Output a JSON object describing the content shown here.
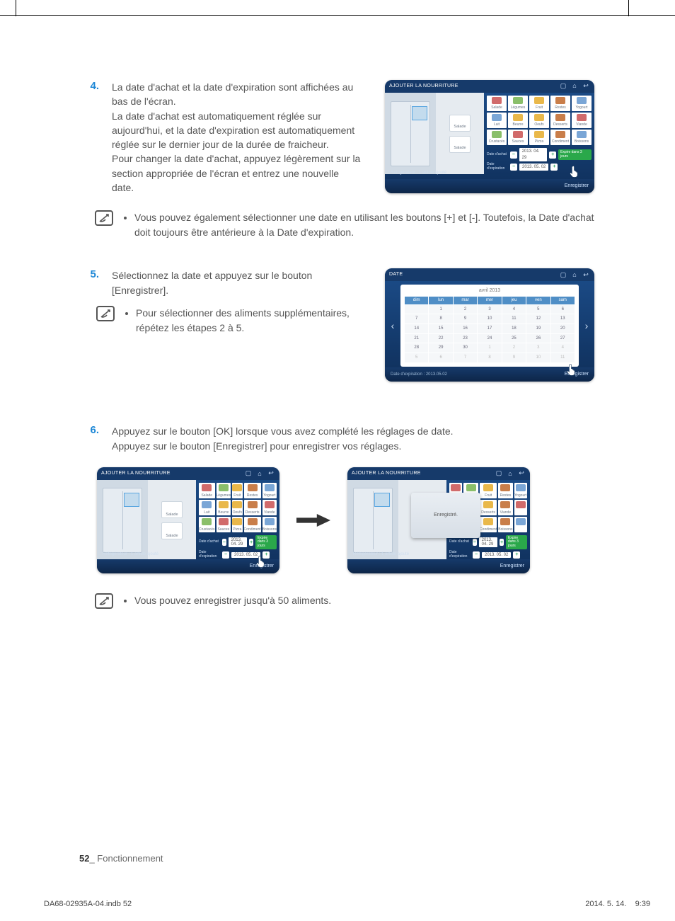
{
  "steps": {
    "s4": {
      "num": "4.",
      "p1": "La date d'achat et la date d'expiration sont affichées au bas de l'écran.",
      "p2": "La date d'achat est automatiquement réglée sur aujourd'hui, et la date d'expiration est automatiquement réglée sur le dernier jour de la durée de fraicheur.",
      "p3": "Pour changer la date d'achat, appuyez légèrement sur la section appropriée de l'écran et entrez une nouvelle date."
    },
    "s5": {
      "num": "5.",
      "p1": "Sélectionnez la date et appuyez sur le bouton [Enregistrer]."
    },
    "s6": {
      "num": "6.",
      "p1": "Appuyez sur le bouton [OK] lorsque vous avez complété les réglages de date.",
      "p2": "Appuyez sur le bouton [Enregistrer] pour enregistrer vos réglages."
    }
  },
  "notes": {
    "n1": "Vous pouvez également sélectionner une date en utilisant les boutons [+] et [-]. Toutefois, la Date d'achat doit toujours être antérieure à la Date d'expiration.",
    "n2": "Pour sélectionner des aliments supplémentaires, répétez les étapes 2 à 5.",
    "n3": "Vous pouvez enregistrer jusqu'à 50 aliments."
  },
  "shot": {
    "title_add": "AJOUTER LA NOURRITURE",
    "title_date": "DATE",
    "status": "Réfrigérateur : 1 article ajouté",
    "save": "Enregistrer",
    "saved_msg": "Enregistré.",
    "food_label": "Salade",
    "purchase_label": "Date d'achat",
    "expiry_label": "Date d'expiration",
    "purchase_value": "2013. 04. 29",
    "expiry_value": "2013. 05. 02",
    "expire_pill": "Expire dans 3 jours",
    "minus": "−",
    "plus": "+",
    "grid_labels": [
      "Salade",
      "Légumes",
      "Fruit",
      "Restes",
      "Yogourt",
      "Lait",
      "Beurre",
      "Oeufs",
      "Desserts",
      "Viande",
      "Crustacés",
      "Sauces",
      "Pizza",
      "Condiment",
      "Boissons"
    ]
  },
  "calendar": {
    "month": "avril 2013",
    "headers": [
      "dim",
      "lun",
      "mar",
      "mer",
      "jeu",
      "ven",
      "sam"
    ],
    "cal_status": "Date d'expiration : 2013.05.02",
    "selected": 29,
    "weeks": [
      [
        " ",
        "1",
        "2",
        "3",
        "4",
        "5",
        "6"
      ],
      [
        "7",
        "8",
        "9",
        "10",
        "11",
        "12",
        "13"
      ],
      [
        "14",
        "15",
        "16",
        "17",
        "18",
        "19",
        "20"
      ],
      [
        "21",
        "22",
        "23",
        "24",
        "25",
        "26",
        "27"
      ],
      [
        "28",
        "29",
        "30",
        " 1",
        " 2",
        " 3",
        " 4"
      ],
      [
        " 5",
        " 6",
        " 7",
        " 8",
        " 9",
        " 10",
        " 11"
      ]
    ]
  },
  "footer": {
    "page": "52",
    "suffix": "_ Fonctionnement"
  },
  "printline": {
    "left": "DA68-02935A-04.indb   52",
    "right": "2014. 5. 14.      9:39"
  }
}
